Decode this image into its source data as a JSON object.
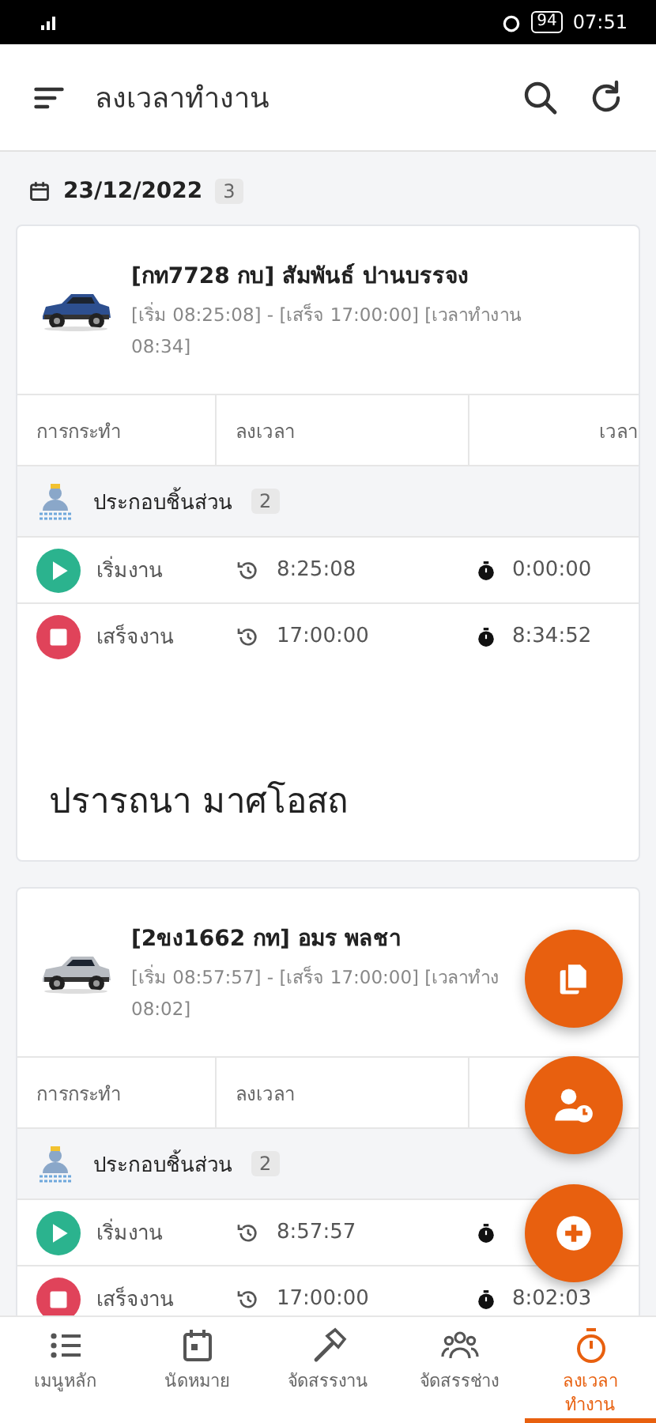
{
  "status_bar": {
    "time": "07:51",
    "battery": "94"
  },
  "app_bar": {
    "title": "ลงเวลาทำงาน"
  },
  "date_header": {
    "date": "23/12/2022",
    "count": "3"
  },
  "cards": [
    {
      "title": "[กท7728 กบ] สัมพันธ์ ปานบรรจง",
      "subtitle_lines": [
        "[เริ่ม 08:25:08] - [เสร็จ 17:00:00] [เวลาทำงาน",
        "08:34]"
      ],
      "columns": [
        "การกระทำ",
        "ลงเวลา",
        "เวลา"
      ],
      "group": {
        "label": "ประกอบชิ้นส่วน",
        "count": "2"
      },
      "rows": [
        {
          "kind": "start",
          "label": "เริ่มงาน",
          "clock": "8:25:08",
          "duration": "0:00:00"
        },
        {
          "kind": "stop",
          "label": "เสร็จงาน",
          "clock": "17:00:00",
          "duration": "8:34:52"
        }
      ],
      "footer_name": "ปรารถนา มาศโอสถ"
    },
    {
      "title": "[2ขง1662 กท] อมร พลชา",
      "subtitle_lines": [
        "[เริ่ม 08:57:57] - [เสร็จ 17:00:00] [เวลาทำง",
        "08:02]"
      ],
      "columns": [
        "การกระทำ",
        "ลงเวลา"
      ],
      "group": {
        "label": "ประกอบชิ้นส่วน",
        "count": "2"
      },
      "rows": [
        {
          "kind": "start",
          "label": "เริ่มงาน",
          "clock": "8:57:57"
        },
        {
          "kind": "stop",
          "label": "เสร็จงาน",
          "clock": "17:00:00",
          "duration": "8:02:03"
        }
      ]
    }
  ],
  "fabs": [
    {
      "kind": "copy"
    },
    {
      "kind": "user-clock"
    },
    {
      "kind": "add"
    }
  ],
  "nav": [
    {
      "kind": "list",
      "label": "เมนูหลัก",
      "selected": false
    },
    {
      "kind": "calendar",
      "label": "นัดหมาย",
      "selected": false
    },
    {
      "kind": "hammer",
      "label": "จัดสรรงาน",
      "selected": false
    },
    {
      "kind": "people",
      "label": "จัดสรรช่าง",
      "selected": false
    },
    {
      "kind": "stopwatch",
      "label": "ลงเวลา ทำงาน",
      "selected": true
    }
  ]
}
